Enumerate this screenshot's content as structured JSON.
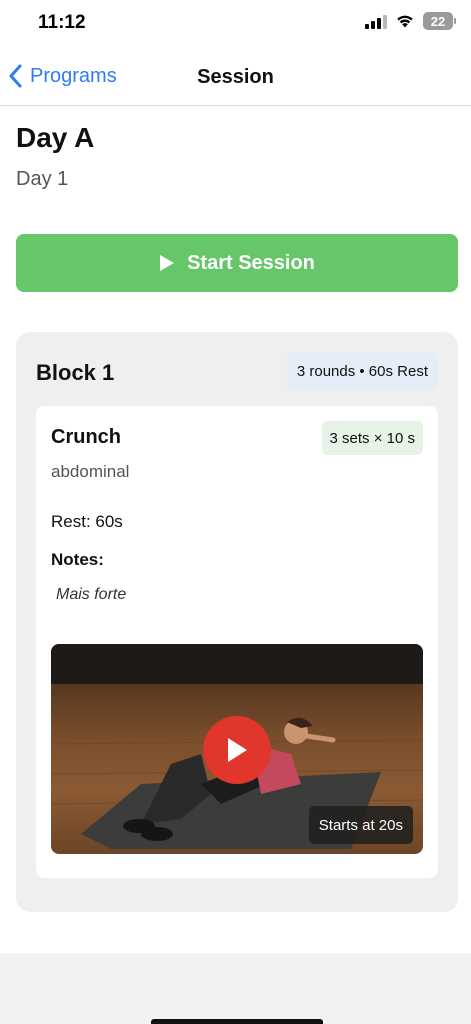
{
  "status_bar": {
    "time": "11:12",
    "battery": "22"
  },
  "nav": {
    "back_label": "Programs",
    "title": "Session"
  },
  "session": {
    "title": "Day A",
    "subtitle": "Day 1",
    "start_label": "Start Session"
  },
  "block": {
    "title": "Block 1",
    "badge": "3 rounds • 60s Rest",
    "exercise": {
      "name": "Crunch",
      "sets_badge": "3 sets × 10 s",
      "muscle": "abdominal",
      "rest": "Rest: 60s",
      "notes_label": "Notes:",
      "notes": "Mais forte",
      "video": {
        "starts_label": "Starts at 20s"
      }
    }
  },
  "colors": {
    "accent": "#2f7bf5",
    "start_button": "#66c66a",
    "play_button": "#e0362b"
  }
}
